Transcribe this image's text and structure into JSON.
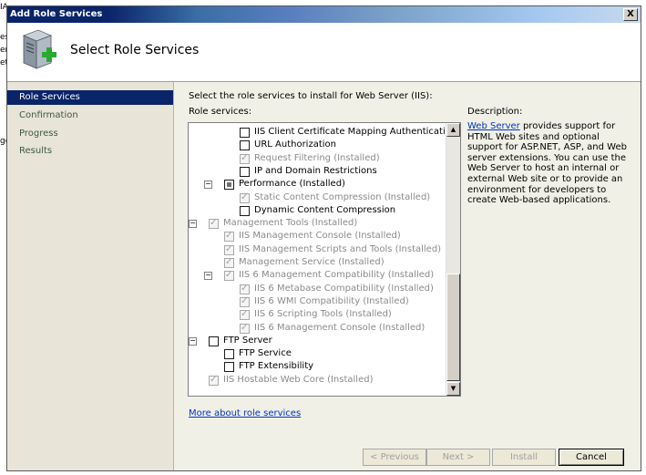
{
  "background": {
    "fragments": [
      "IA",
      "es",
      "er",
      "et",
      "ge"
    ]
  },
  "window": {
    "title": "Add Role Services",
    "close_label": "X",
    "page_title": "Select Role Services"
  },
  "sidebar": {
    "items": [
      {
        "label": "Role Services",
        "active": true
      },
      {
        "label": "Confirmation",
        "active": false
      },
      {
        "label": "Progress",
        "active": false
      },
      {
        "label": "Results",
        "active": false
      }
    ]
  },
  "content": {
    "instruction": "Select the role services to install for Web Server (IIS):",
    "role_services_label": "Role services:",
    "description_label": "Description:",
    "description_link": "Web Server",
    "description_text": " provides support for HTML Web sites and optional support for ASP.NET, ASP, and Web server extensions. You can use the Web Server to host an internal or external Web site or to provide an environment for developers to create Web-based applications.",
    "more_link": "More about role services"
  },
  "tree": {
    "rows": [
      {
        "label": "IIS Client Certificate Mapping Authentication",
        "level": 3,
        "checked": false,
        "disabled": false,
        "expander": null
      },
      {
        "label": "URL Authorization",
        "level": 3,
        "checked": false,
        "disabled": false,
        "expander": null
      },
      {
        "label": "Request Filtering  (Installed)",
        "level": 3,
        "checked": true,
        "disabled": true,
        "expander": null
      },
      {
        "label": "IP and Domain Restrictions",
        "level": 3,
        "checked": false,
        "disabled": false,
        "expander": null
      },
      {
        "label": "Performance  (Installed)",
        "level": 2,
        "checked": "partial",
        "disabled": false,
        "expander": "−"
      },
      {
        "label": "Static Content Compression  (Installed)",
        "level": 3,
        "checked": true,
        "disabled": true,
        "expander": null
      },
      {
        "label": "Dynamic Content Compression",
        "level": 3,
        "checked": false,
        "disabled": false,
        "expander": null
      },
      {
        "label": "Management Tools  (Installed)",
        "level": 1,
        "checked": true,
        "disabled": true,
        "expander": "−"
      },
      {
        "label": "IIS Management Console  (Installed)",
        "level": 2,
        "checked": true,
        "disabled": true,
        "expander": null
      },
      {
        "label": "IIS Management Scripts and Tools  (Installed)",
        "level": 2,
        "checked": true,
        "disabled": true,
        "expander": null
      },
      {
        "label": "Management Service  (Installed)",
        "level": 2,
        "checked": true,
        "disabled": true,
        "expander": null
      },
      {
        "label": "IIS 6 Management Compatibility  (Installed)",
        "level": 2,
        "checked": true,
        "disabled": true,
        "expander": "−"
      },
      {
        "label": "IIS 6 Metabase Compatibility  (Installed)",
        "level": 3,
        "checked": true,
        "disabled": true,
        "expander": null
      },
      {
        "label": "IIS 6 WMI Compatibility  (Installed)",
        "level": 3,
        "checked": true,
        "disabled": true,
        "expander": null
      },
      {
        "label": "IIS 6 Scripting Tools  (Installed)",
        "level": 3,
        "checked": true,
        "disabled": true,
        "expander": null
      },
      {
        "label": "IIS 6 Management Console  (Installed)",
        "level": 3,
        "checked": true,
        "disabled": true,
        "expander": null
      },
      {
        "label": "FTP Server",
        "level": 1,
        "checked": false,
        "disabled": false,
        "expander": "−"
      },
      {
        "label": "FTP Service",
        "level": 2,
        "checked": false,
        "disabled": false,
        "expander": null
      },
      {
        "label": "FTP Extensibility",
        "level": 2,
        "checked": false,
        "disabled": false,
        "expander": null
      },
      {
        "label": "IIS Hostable Web Core  (Installed)",
        "level": 1,
        "checked": true,
        "disabled": true,
        "expander": null
      }
    ]
  },
  "buttons": {
    "previous": "< Previous",
    "next": "Next >",
    "install": "Install",
    "cancel": "Cancel"
  },
  "colors": {
    "titlebar": "#0a246a",
    "selection": "#0a246a",
    "link": "#0033cc"
  }
}
